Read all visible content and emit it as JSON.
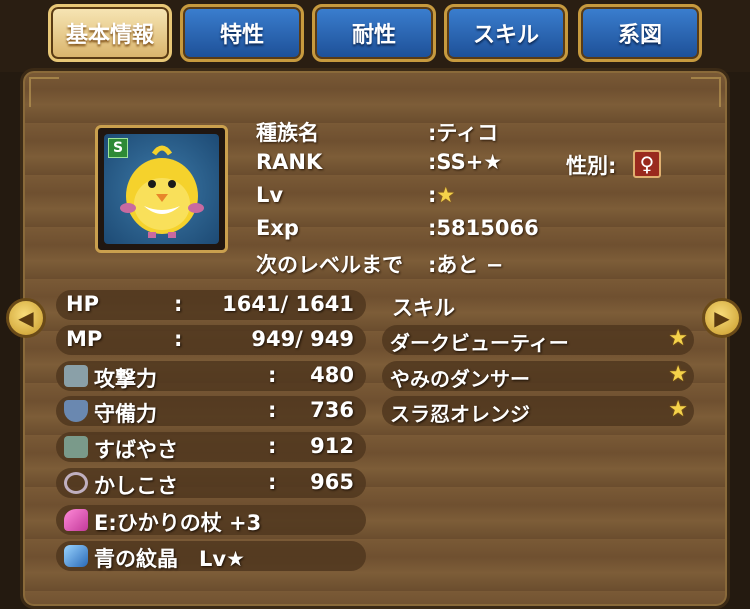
{
  "tabs": [
    "基本情報",
    "特性",
    "耐性",
    "スキル",
    "系図"
  ],
  "monster": {
    "rank_badge": "S",
    "species_label": "種族名",
    "species_value": ":ティコ",
    "rank_label": "RANK",
    "rank_value": ":SS+★",
    "gender_label": "性別:",
    "gender_symbol": "♀",
    "lv_label": "Lv",
    "lv_value": ":",
    "lv_star": "★",
    "exp_label": "Exp",
    "exp_value": ":5815066",
    "next_label": "次のレベルまで",
    "next_value": ":あと −"
  },
  "stats": [
    {
      "label": "HP",
      "sep": ":",
      "value": "1641/ 1641"
    },
    {
      "label": "MP",
      "sep": ":",
      "value": "949/ 949"
    },
    {
      "label": "攻撃力",
      "sep": ":",
      "value": "480",
      "icon": "sword-icon"
    },
    {
      "label": "守備力",
      "sep": ":",
      "value": "736",
      "icon": "shield-icon"
    },
    {
      "label": "すばやさ",
      "sep": ":",
      "value": "912",
      "icon": "boot-icon"
    },
    {
      "label": "かしこさ",
      "sep": ":",
      "value": "965",
      "icon": "ring-icon"
    }
  ],
  "equipment": {
    "weapon": "E:ひかりの杖 +3",
    "crystal": "青の紋晶　Lv★"
  },
  "skills": {
    "header": "スキル",
    "items": [
      {
        "name": "ダークビューティー",
        "star": "★"
      },
      {
        "name": "やみのダンサー",
        "star": "★"
      },
      {
        "name": "スラ忍オレンジ",
        "star": "★"
      }
    ]
  },
  "colors": {
    "accent_gold": "#c79a3e",
    "tab_blue": "#2f6fc0",
    "star": "#f4d24a"
  }
}
